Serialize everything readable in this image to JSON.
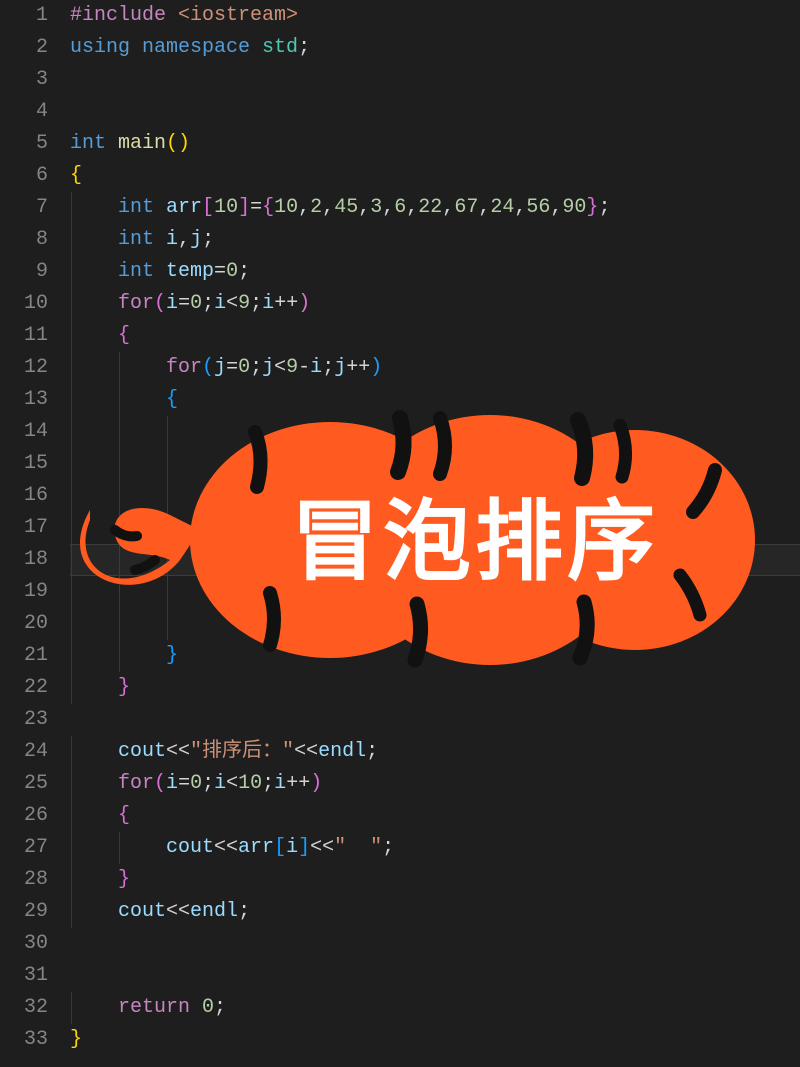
{
  "editor": {
    "line_numbers": [
      "1",
      "2",
      "3",
      "4",
      "5",
      "6",
      "7",
      "8",
      "9",
      "10",
      "11",
      "12",
      "13",
      "14",
      "15",
      "16",
      "17",
      "18",
      "19",
      "20",
      "21",
      "22",
      "23",
      "24",
      "25",
      "26",
      "27",
      "28",
      "29",
      "30",
      "31",
      "32",
      "33"
    ],
    "lines": [
      [
        {
          "t": "#include ",
          "c": "c-preproc"
        },
        {
          "t": "<iostream>",
          "c": "c-str"
        }
      ],
      [
        {
          "t": "using ",
          "c": "c-keyword"
        },
        {
          "t": "namespace ",
          "c": "c-keyword"
        },
        {
          "t": "std",
          "c": "c-ns"
        },
        {
          "t": ";",
          "c": "c-punct"
        }
      ],
      [],
      [],
      [
        {
          "t": "int ",
          "c": "c-type"
        },
        {
          "t": "main",
          "c": "c-func"
        },
        {
          "t": "()",
          "c": "c-brace"
        }
      ],
      [
        {
          "t": "{",
          "c": "c-brace"
        }
      ],
      [
        {
          "t": "    ",
          "c": ""
        },
        {
          "t": "int ",
          "c": "c-type"
        },
        {
          "t": "arr",
          "c": "c-var"
        },
        {
          "t": "[",
          "c": "c-brace2"
        },
        {
          "t": "10",
          "c": "c-num"
        },
        {
          "t": "]",
          "c": "c-brace2"
        },
        {
          "t": "=",
          "c": "c-op"
        },
        {
          "t": "{",
          "c": "c-brace2"
        },
        {
          "t": "10",
          "c": "c-num"
        },
        {
          "t": ",",
          "c": "c-punct"
        },
        {
          "t": "2",
          "c": "c-num"
        },
        {
          "t": ",",
          "c": "c-punct"
        },
        {
          "t": "45",
          "c": "c-num"
        },
        {
          "t": ",",
          "c": "c-punct"
        },
        {
          "t": "3",
          "c": "c-num"
        },
        {
          "t": ",",
          "c": "c-punct"
        },
        {
          "t": "6",
          "c": "c-num"
        },
        {
          "t": ",",
          "c": "c-punct"
        },
        {
          "t": "22",
          "c": "c-num"
        },
        {
          "t": ",",
          "c": "c-punct"
        },
        {
          "t": "67",
          "c": "c-num"
        },
        {
          "t": ",",
          "c": "c-punct"
        },
        {
          "t": "24",
          "c": "c-num"
        },
        {
          "t": ",",
          "c": "c-punct"
        },
        {
          "t": "56",
          "c": "c-num"
        },
        {
          "t": ",",
          "c": "c-punct"
        },
        {
          "t": "90",
          "c": "c-num"
        },
        {
          "t": "}",
          "c": "c-brace2"
        },
        {
          "t": ";",
          "c": "c-punct"
        }
      ],
      [
        {
          "t": "    ",
          "c": ""
        },
        {
          "t": "int ",
          "c": "c-type"
        },
        {
          "t": "i",
          "c": "c-var"
        },
        {
          "t": ",",
          "c": "c-punct"
        },
        {
          "t": "j",
          "c": "c-var"
        },
        {
          "t": ";",
          "c": "c-punct"
        }
      ],
      [
        {
          "t": "    ",
          "c": ""
        },
        {
          "t": "int ",
          "c": "c-type"
        },
        {
          "t": "temp",
          "c": "c-var"
        },
        {
          "t": "=",
          "c": "c-op"
        },
        {
          "t": "0",
          "c": "c-num"
        },
        {
          "t": ";",
          "c": "c-punct"
        }
      ],
      [
        {
          "t": "    ",
          "c": ""
        },
        {
          "t": "for",
          "c": "c-control"
        },
        {
          "t": "(",
          "c": "c-brace2"
        },
        {
          "t": "i",
          "c": "c-var"
        },
        {
          "t": "=",
          "c": "c-op"
        },
        {
          "t": "0",
          "c": "c-num"
        },
        {
          "t": ";",
          "c": "c-punct"
        },
        {
          "t": "i",
          "c": "c-var"
        },
        {
          "t": "<",
          "c": "c-op"
        },
        {
          "t": "9",
          "c": "c-num"
        },
        {
          "t": ";",
          "c": "c-punct"
        },
        {
          "t": "i",
          "c": "c-var"
        },
        {
          "t": "++",
          "c": "c-op"
        },
        {
          "t": ")",
          "c": "c-brace2"
        }
      ],
      [
        {
          "t": "    ",
          "c": ""
        },
        {
          "t": "{",
          "c": "c-brace2"
        }
      ],
      [
        {
          "t": "        ",
          "c": ""
        },
        {
          "t": "for",
          "c": "c-control"
        },
        {
          "t": "(",
          "c": "c-brace3"
        },
        {
          "t": "j",
          "c": "c-var"
        },
        {
          "t": "=",
          "c": "c-op"
        },
        {
          "t": "0",
          "c": "c-num"
        },
        {
          "t": ";",
          "c": "c-punct"
        },
        {
          "t": "j",
          "c": "c-var"
        },
        {
          "t": "<",
          "c": "c-op"
        },
        {
          "t": "9",
          "c": "c-num"
        },
        {
          "t": "-",
          "c": "c-op"
        },
        {
          "t": "i",
          "c": "c-var"
        },
        {
          "t": ";",
          "c": "c-punct"
        },
        {
          "t": "j",
          "c": "c-var"
        },
        {
          "t": "++",
          "c": "c-op"
        },
        {
          "t": ")",
          "c": "c-brace3"
        }
      ],
      [
        {
          "t": "        ",
          "c": ""
        },
        {
          "t": "{",
          "c": "c-brace3"
        }
      ],
      [
        {
          "t": "            ",
          "c": ""
        }
      ],
      [
        {
          "t": "            ",
          "c": ""
        }
      ],
      [
        {
          "t": "            ",
          "c": ""
        }
      ],
      [
        {
          "t": "            ",
          "c": ""
        }
      ],
      [
        {
          "t": "            ",
          "c": ""
        }
      ],
      [
        {
          "t": "            ",
          "c": ""
        }
      ],
      [
        {
          "t": "            ",
          "c": ""
        }
      ],
      [
        {
          "t": "        ",
          "c": ""
        },
        {
          "t": "}",
          "c": "c-brace3"
        }
      ],
      [
        {
          "t": "    ",
          "c": ""
        },
        {
          "t": "}",
          "c": "c-brace2"
        }
      ],
      [],
      [
        {
          "t": "    ",
          "c": ""
        },
        {
          "t": "cout",
          "c": "c-obj"
        },
        {
          "t": "<<",
          "c": "c-op"
        },
        {
          "t": "\"排序后：\"",
          "c": "c-str"
        },
        {
          "t": "<<",
          "c": "c-op"
        },
        {
          "t": "endl",
          "c": "c-var"
        },
        {
          "t": ";",
          "c": "c-punct"
        }
      ],
      [
        {
          "t": "    ",
          "c": ""
        },
        {
          "t": "for",
          "c": "c-control"
        },
        {
          "t": "(",
          "c": "c-brace2"
        },
        {
          "t": "i",
          "c": "c-var"
        },
        {
          "t": "=",
          "c": "c-op"
        },
        {
          "t": "0",
          "c": "c-num"
        },
        {
          "t": ";",
          "c": "c-punct"
        },
        {
          "t": "i",
          "c": "c-var"
        },
        {
          "t": "<",
          "c": "c-op"
        },
        {
          "t": "10",
          "c": "c-num"
        },
        {
          "t": ";",
          "c": "c-punct"
        },
        {
          "t": "i",
          "c": "c-var"
        },
        {
          "t": "++",
          "c": "c-op"
        },
        {
          "t": ")",
          "c": "c-brace2"
        }
      ],
      [
        {
          "t": "    ",
          "c": ""
        },
        {
          "t": "{",
          "c": "c-brace2"
        }
      ],
      [
        {
          "t": "        ",
          "c": ""
        },
        {
          "t": "cout",
          "c": "c-obj"
        },
        {
          "t": "<<",
          "c": "c-op"
        },
        {
          "t": "arr",
          "c": "c-var"
        },
        {
          "t": "[",
          "c": "c-brace3"
        },
        {
          "t": "i",
          "c": "c-var"
        },
        {
          "t": "]",
          "c": "c-brace3"
        },
        {
          "t": "<<",
          "c": "c-op"
        },
        {
          "t": "\"  \"",
          "c": "c-str"
        },
        {
          "t": ";",
          "c": "c-punct"
        }
      ],
      [
        {
          "t": "    ",
          "c": ""
        },
        {
          "t": "}",
          "c": "c-brace2"
        }
      ],
      [
        {
          "t": "    ",
          "c": ""
        },
        {
          "t": "cout",
          "c": "c-obj"
        },
        {
          "t": "<<",
          "c": "c-op"
        },
        {
          "t": "endl",
          "c": "c-var"
        },
        {
          "t": ";",
          "c": "c-punct"
        }
      ],
      [],
      [],
      [
        {
          "t": "    ",
          "c": ""
        },
        {
          "t": "return ",
          "c": "c-control"
        },
        {
          "t": "0",
          "c": "c-num"
        },
        {
          "t": ";",
          "c": "c-punct"
        }
      ],
      [
        {
          "t": "}",
          "c": "c-brace"
        }
      ]
    ],
    "current_line_index": 17
  },
  "sticker": {
    "text": "冒泡排序",
    "fill": "#ff5a1f",
    "text_color": "#ffffff"
  }
}
